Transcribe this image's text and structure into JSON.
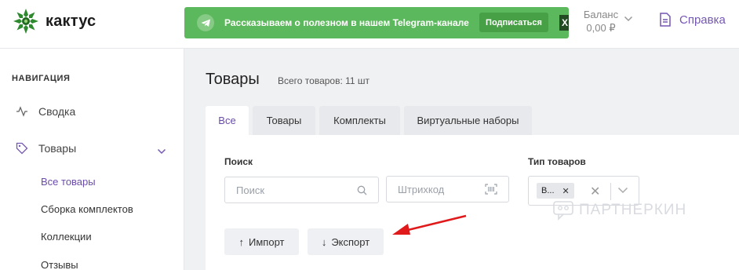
{
  "header": {
    "logo_text": "кактус",
    "banner": {
      "text": "Рассказываем о полезном в нашем Telegram-канале",
      "button_label": "Подписаться",
      "close_label": "X"
    },
    "balance": {
      "label": "Баланс",
      "value": "0,00 ₽"
    },
    "help_label": "Справка"
  },
  "sidebar": {
    "title": "НАВИГАЦИЯ",
    "items": [
      {
        "label": "Сводка",
        "icon": "activity-icon"
      },
      {
        "label": "Товары",
        "icon": "tag-icon"
      }
    ],
    "subitems": [
      {
        "label": "Все товары",
        "active": true
      },
      {
        "label": "Сборка комплектов"
      },
      {
        "label": "Коллекции"
      },
      {
        "label": "Отзывы"
      }
    ]
  },
  "main": {
    "title": "Товары",
    "subtitle": "Всего товаров: 11 шт",
    "tabs": [
      {
        "label": "Все",
        "active": true
      },
      {
        "label": "Товары"
      },
      {
        "label": "Комплекты"
      },
      {
        "label": "Виртуальные наборы"
      }
    ],
    "filters": {
      "search_label": "Поиск",
      "search_placeholder": "Поиск",
      "barcode_placeholder": "Штрихкод",
      "type_label": "Тип товаров",
      "type_chip": "В..."
    },
    "buttons": {
      "import": "Импорт",
      "export": "Экспорт"
    }
  },
  "watermark": "ПАРТНЕРКИН",
  "colors": {
    "accent": "#6a4ca8",
    "banner_green": "#5cb85c",
    "logo_green": "#2f8a2f",
    "annotation_arrow": "#e0191b"
  }
}
